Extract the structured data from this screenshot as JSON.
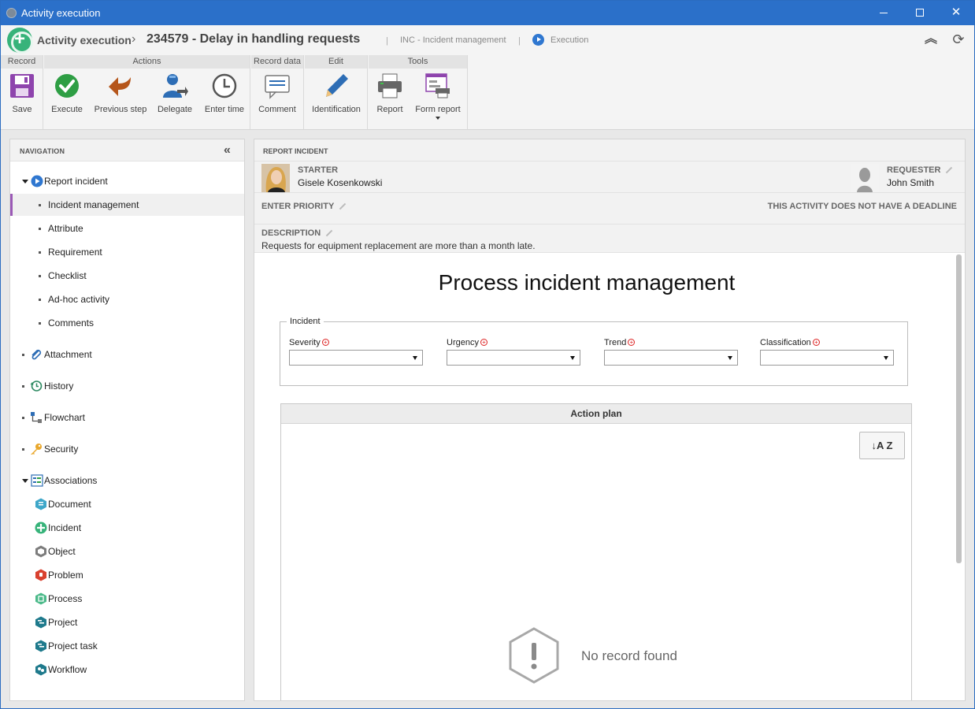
{
  "window": {
    "title": "Activity execution"
  },
  "header": {
    "crumb_module": "Activity execution",
    "crumb_record": "234579 - Delay in handling requests",
    "crumb_process": "INC - Incident management",
    "crumb_status": "Execution"
  },
  "ribbon": {
    "groups": {
      "record": "Record",
      "actions": "Actions",
      "record_data": "Record data",
      "edit": "Edit",
      "tools": "Tools"
    },
    "buttons": {
      "save": "Save",
      "execute": "Execute",
      "previous_step": "Previous step",
      "delegate": "Delegate",
      "enter_time": "Enter time",
      "comment": "Comment",
      "identification": "Identification",
      "report": "Report",
      "form_report": "Form report"
    }
  },
  "navigation": {
    "title": "NAVIGATION",
    "items": [
      {
        "label": "Report incident"
      },
      {
        "label": "Incident management"
      },
      {
        "label": "Attribute"
      },
      {
        "label": "Requirement"
      },
      {
        "label": "Checklist"
      },
      {
        "label": "Ad-hoc activity"
      },
      {
        "label": "Comments"
      },
      {
        "label": "Attachment"
      },
      {
        "label": "History"
      },
      {
        "label": "Flowchart"
      },
      {
        "label": "Security"
      },
      {
        "label": "Associations"
      },
      {
        "label": "Document"
      },
      {
        "label": "Incident"
      },
      {
        "label": "Object"
      },
      {
        "label": "Problem"
      },
      {
        "label": "Process"
      },
      {
        "label": "Project"
      },
      {
        "label": "Project task"
      },
      {
        "label": "Workflow"
      }
    ]
  },
  "main": {
    "title": "REPORT INCIDENT",
    "starter_label": "STARTER",
    "starter_name": "Gisele Kosenkowski",
    "requester_label": "REQUESTER",
    "requester_name": "John Smith",
    "priority_label": "ENTER PRIORITY",
    "deadline_text": "THIS ACTIVITY DOES NOT HAVE A DEADLINE",
    "description_label": "DESCRIPTION",
    "description_text": "Requests for equipment replacement are more than a month late."
  },
  "form": {
    "title": "Process incident management",
    "fieldset_legend": "Incident",
    "fields": [
      {
        "label": "Severity",
        "value": ""
      },
      {
        "label": "Urgency",
        "value": ""
      },
      {
        "label": "Trend",
        "value": ""
      },
      {
        "label": "Classification",
        "value": ""
      }
    ],
    "action_plan": {
      "title": "Action plan",
      "sort_label": "↓A Z",
      "empty_text": "No record found"
    }
  },
  "colors": {
    "titlebar": "#2b70c9",
    "selected_nav_accent": "#9b59b6",
    "execute_green": "#2e9e44",
    "required_red": "#dd2222"
  }
}
